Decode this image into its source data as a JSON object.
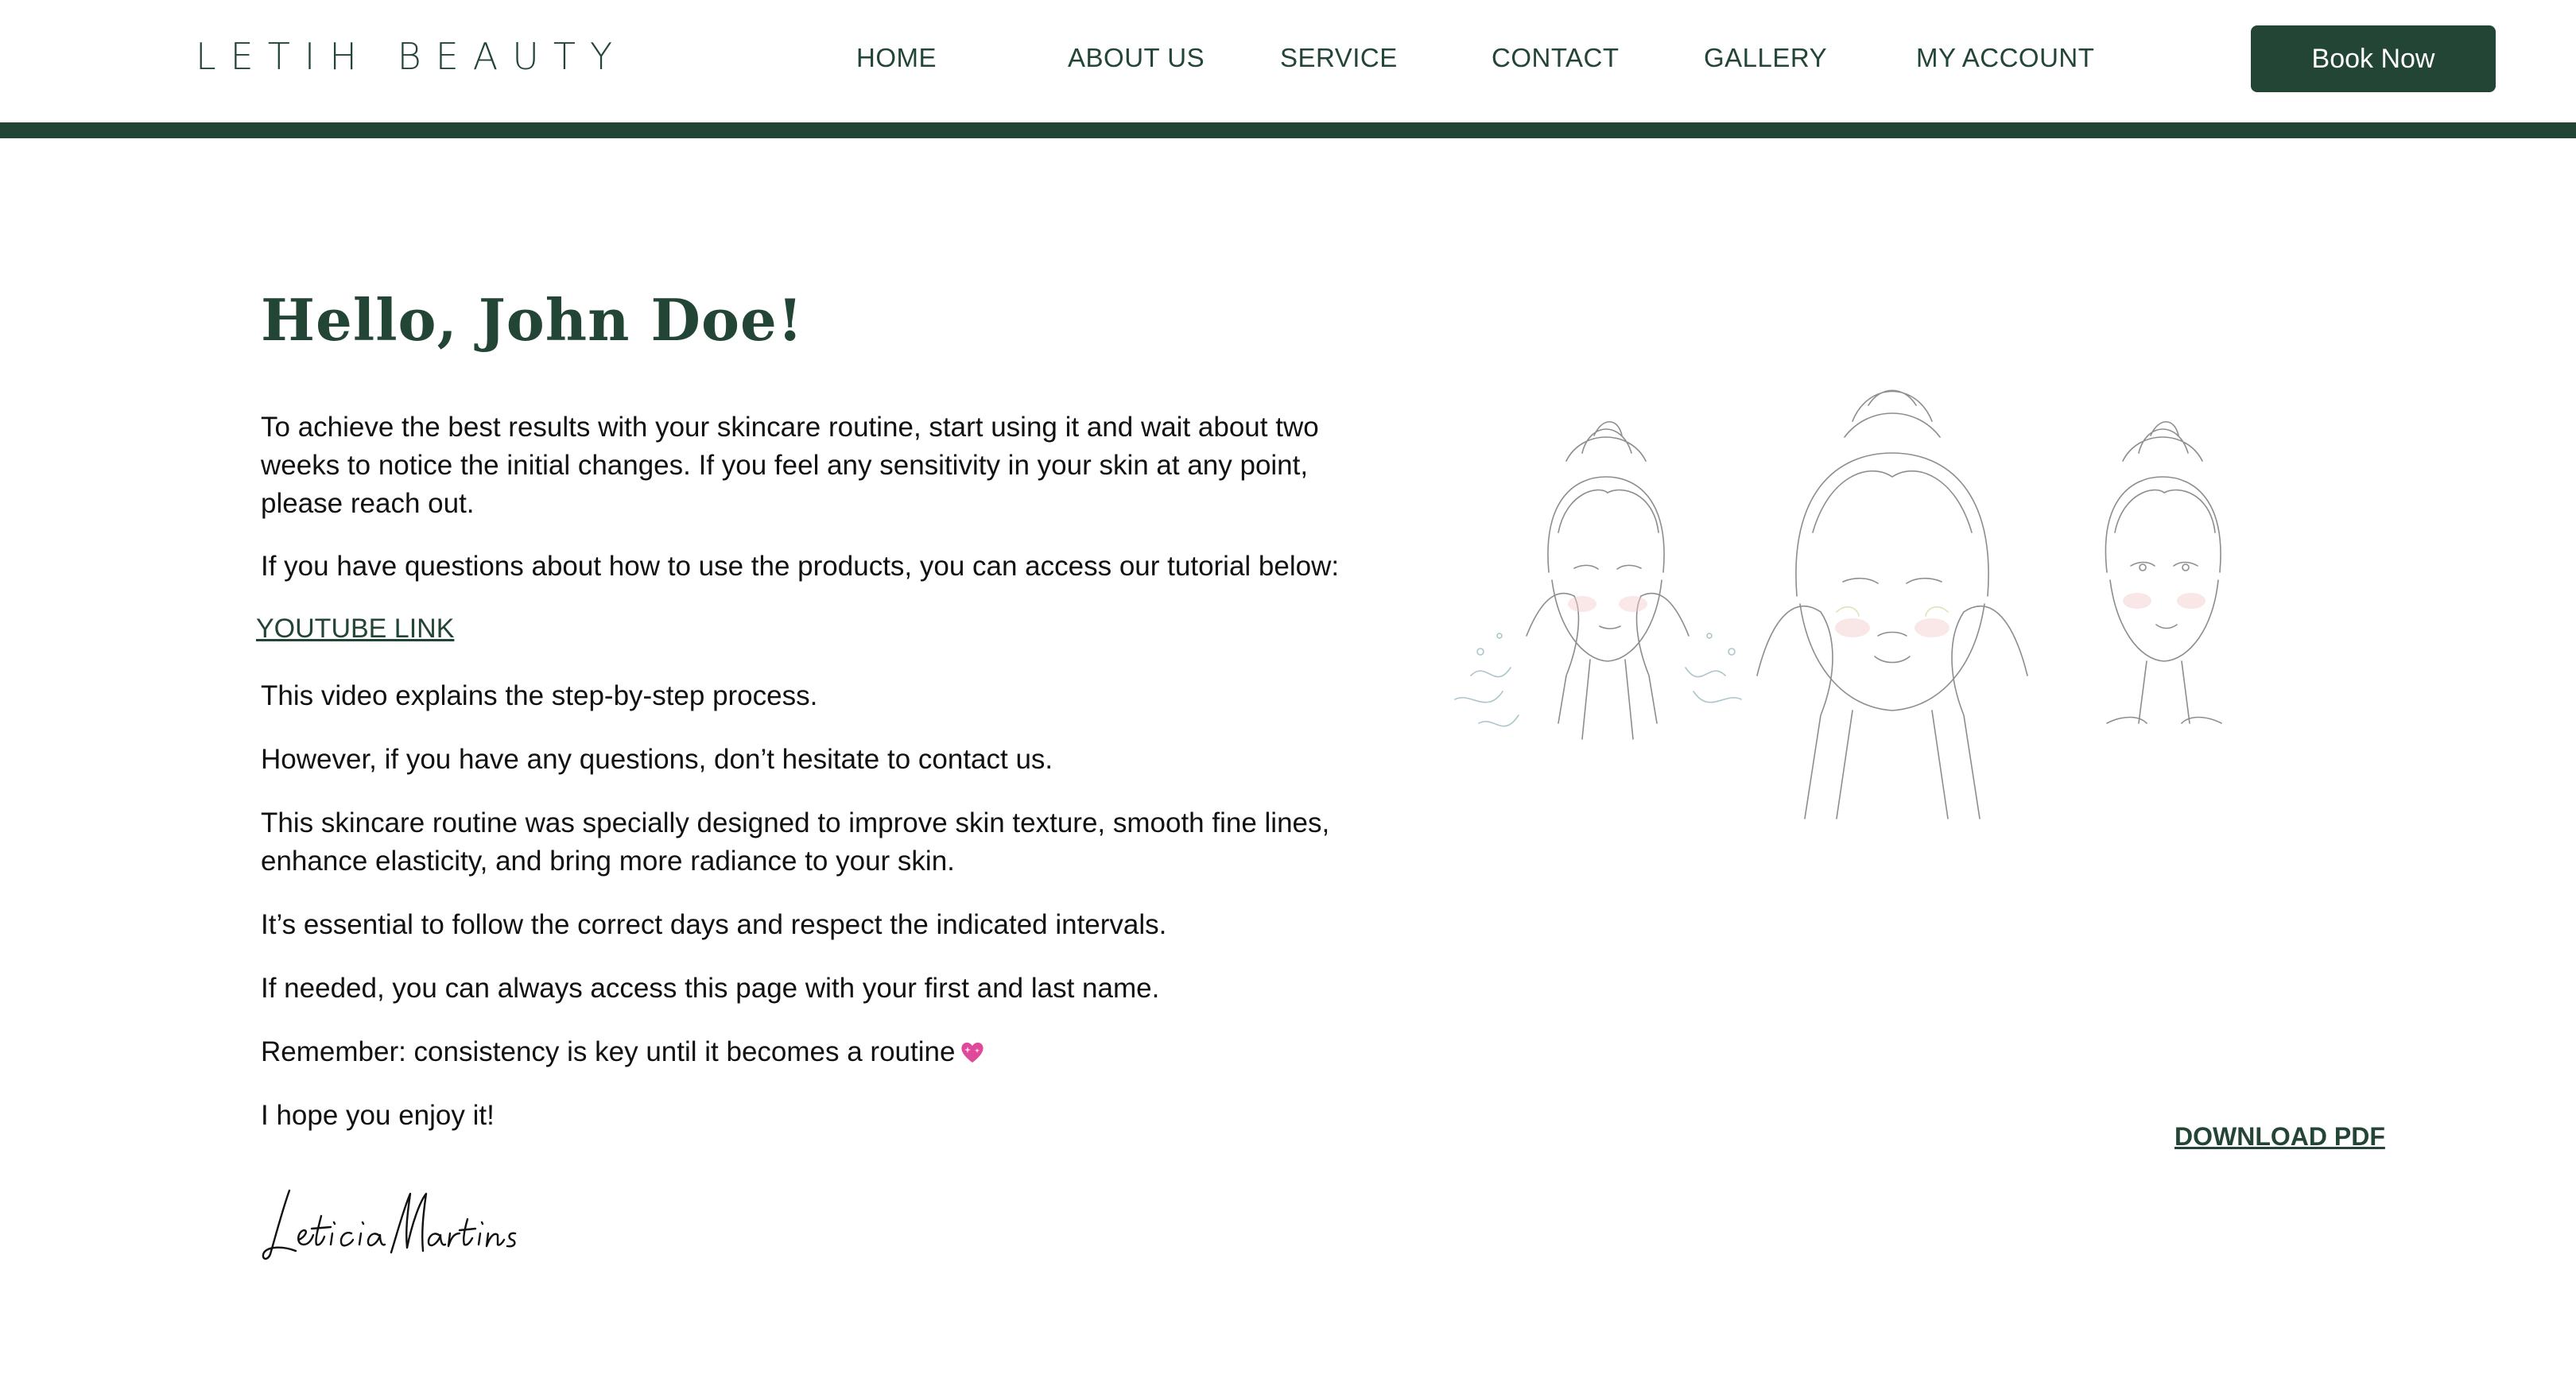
{
  "header": {
    "logo": "LETIH BEAUTY",
    "nav": [
      "HOME",
      "ABOUT US",
      "SERVICE",
      "CONTACT",
      "GALLERY",
      "MY ACCOUNT"
    ],
    "book_button": "Book Now"
  },
  "main": {
    "greeting": "Hello, John Doe!",
    "paragraphs": [
      "To achieve the best results with your skincare routine, start using it and wait about two weeks to notice the initial changes. If you feel any sensitivity in your skin at any point, please reach out.",
      "If you have questions about how to use the products, you can access our tutorial below:",
      "This video explains the step-by-step process.",
      "However, if you have any questions, don’t hesitate to contact us.",
      "This skincare routine was specially designed to improve skin texture, smooth fine lines, enhance elasticity, and bring more radiance to your skin.",
      "It’s essential to follow the correct days and respect the indicated intervals.",
      "If needed, you can always access this page with your first and last name.",
      "Remember: consistency is key until it becomes a routine",
      "I hope you enjoy it!"
    ],
    "youtube_link": "YOUTUBE LINK",
    "signature": "Leticia Martins",
    "download_link": "DOWNLOAD PDF"
  },
  "colors": {
    "brand_green": "#234536",
    "text": "#111111",
    "heart": "#e0489a"
  },
  "icons": {
    "heart": "sparkling-heart-icon"
  }
}
